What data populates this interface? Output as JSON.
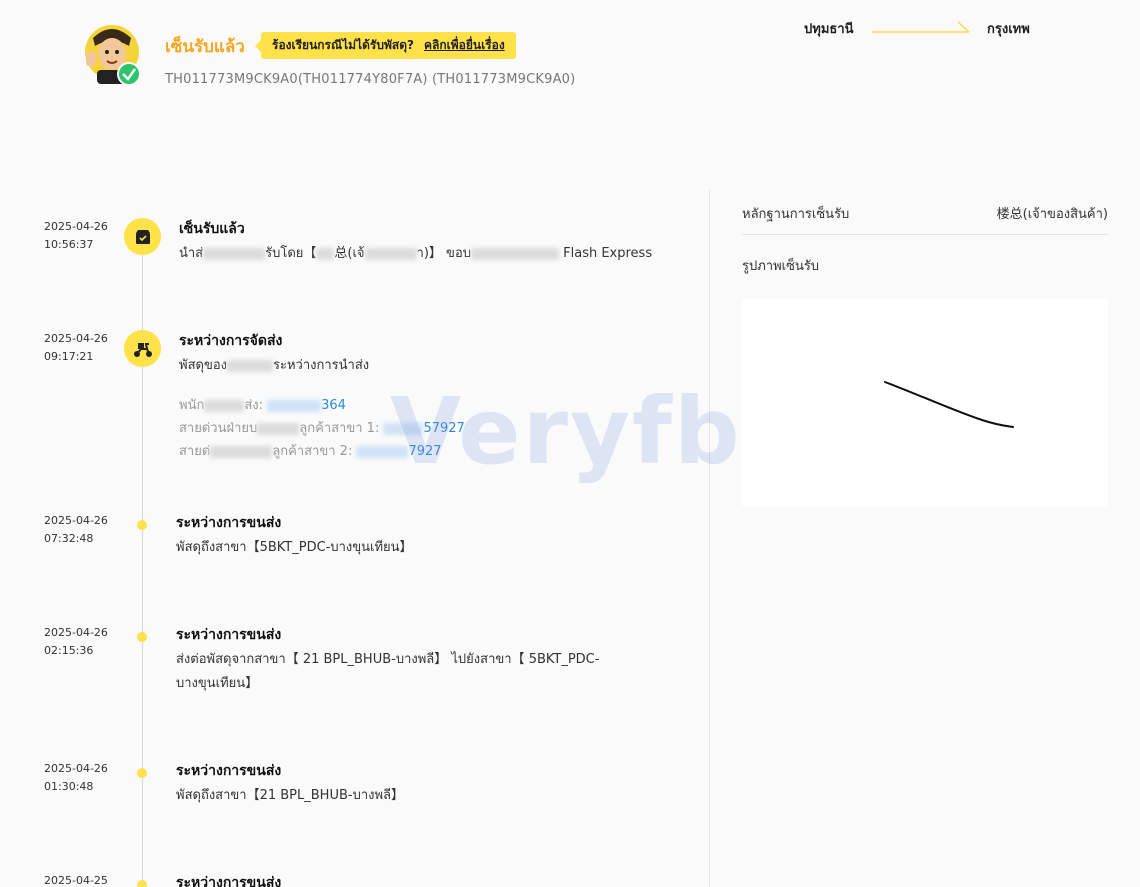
{
  "header": {
    "status_title": "เซ็นรับแล้ว",
    "complaint_text": "ร้องเรียนกรณีไม่ได้รับพัสดุ?",
    "complaint_link": "คลิกเพื่อยื่นเรื่อง",
    "tracking": "TH011773M9CK9A0(TH011774Y80F7A) (TH011773M9CK9A0)",
    "route_origin": "ปทุมธานี",
    "route_dest": "กรุงเทพ"
  },
  "events": [
    {
      "date": "2025-04-26",
      "time": "10:56:37",
      "title": "เซ็นรับแล้ว",
      "desc_a": "นำส่",
      "desc_b": "รับโดย【",
      "desc_c": "总(เจ้",
      "desc_d": "า)】 ขอบ",
      "desc_e": "Flash Express",
      "icon": "box-check-icon"
    },
    {
      "date": "2025-04-26",
      "time": "09:17:21",
      "title": "ระหว่างการจัดส่ง",
      "desc_a": "พัสดุของ",
      "desc_b": "ระหว่างการนำส่ง",
      "courier_label": "พนัก",
      "courier_label2": "ส่ง:",
      "courier_phone": "364",
      "hotline1_label": "สายด่วนฝ่ายบ",
      "hotline1_label2": "ลูกค้าสาขา 1:",
      "hotline1_phone": "57927",
      "hotline2_label": "สายด่",
      "hotline2_label2": "ลูกค้าสาขา 2:",
      "hotline2_phone": "7927",
      "icon": "scooter-icon"
    },
    {
      "date": "2025-04-26",
      "time": "07:32:48",
      "title": "ระหว่างการขนส่ง",
      "desc": "พัสดุถึงสาขา【5BKT_PDC-บางขุนเทียน】"
    },
    {
      "date": "2025-04-26",
      "time": "02:15:36",
      "title": "ระหว่างการขนส่ง",
      "desc_line1": "ส่งต่อพัสดุจากสาขา【 21 BPL_BHUB-บางพลี】 ไปยังสาขา【 5BKT_PDC-",
      "desc_line2": "บางขุนเทียน】"
    },
    {
      "date": "2025-04-26",
      "time": "01:30:48",
      "title": "ระหว่างการขนส่ง",
      "desc": "พัสดุถึงสาขา【21 BPL_BHUB-บางพลี】"
    },
    {
      "date": "2025-04-25",
      "time": "",
      "title": "ระหว่างการขนส่ง"
    }
  ],
  "proof": {
    "label": "หลักฐานการเซ็นรับ",
    "value": "楼总(เจ้าของสินค้า)",
    "photo_label": "รูปภาพเซ็นรับ"
  },
  "watermark": "Veryfb",
  "colors": {
    "accent": "#ffe14a",
    "status": "#f6a623",
    "link": "#2b8ae0"
  }
}
